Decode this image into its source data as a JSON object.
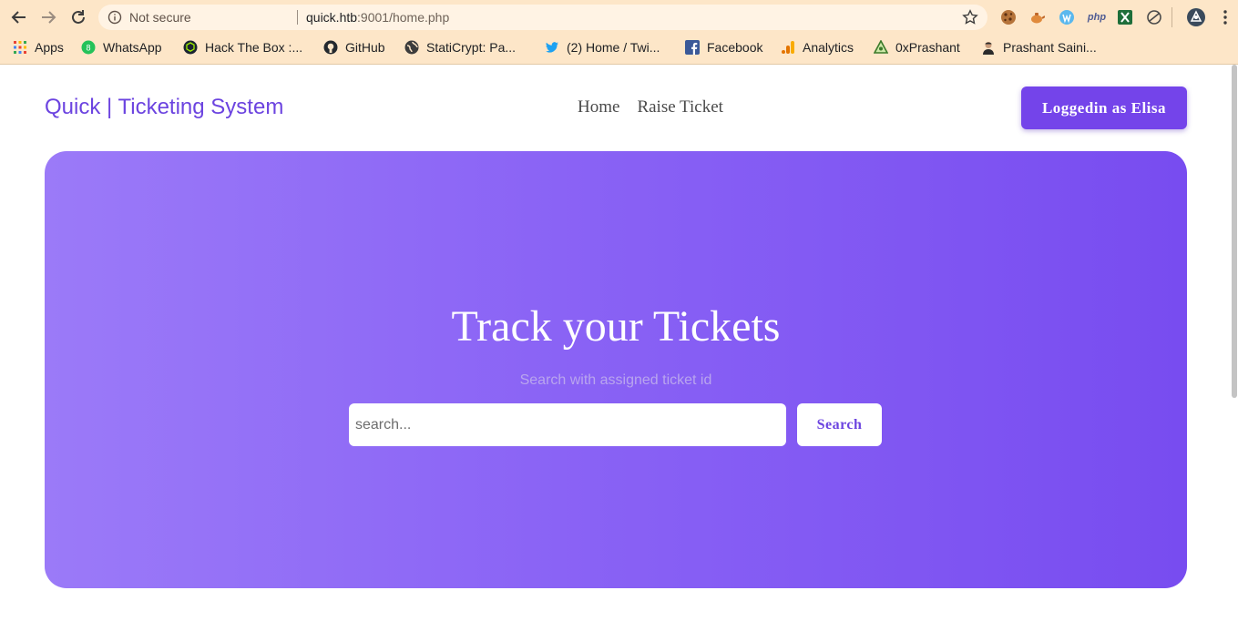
{
  "browser": {
    "security_label": "Not secure",
    "url_host": "quick.htb",
    "url_rest": ":9001/home.php",
    "bookmarks": [
      {
        "label": "Apps",
        "icon": "apps-grid-icon"
      },
      {
        "label": "WhatsApp",
        "icon": "whatsapp-icon"
      },
      {
        "label": "Hack The Box :...",
        "icon": "hackthebox-icon"
      },
      {
        "label": "GitHub",
        "icon": "github-icon"
      },
      {
        "label": "StatiCrypt: Pa...",
        "icon": "globe-icon"
      },
      {
        "label": "(2) Home / Twi...",
        "icon": "twitter-icon"
      },
      {
        "label": "Facebook",
        "icon": "facebook-icon"
      },
      {
        "label": "Analytics",
        "icon": "analytics-icon"
      },
      {
        "label": "0xPrashant",
        "icon": "triangle-logo-icon"
      },
      {
        "label": "Prashant Saini...",
        "icon": "avatar-icon"
      }
    ],
    "extension_php_label": "php"
  },
  "header": {
    "brand": "Quick | Ticketing System",
    "nav": [
      "Home",
      "Raise Ticket"
    ],
    "login_label": "Loggedin as Elisa"
  },
  "hero": {
    "title": "Track your Tickets",
    "subtitle": "Search with assigned ticket id",
    "search_placeholder": "search...",
    "search_button": "Search"
  },
  "colors": {
    "accent": "#7444ea",
    "hero_gradient_start": "#9b7af8",
    "hero_gradient_end": "#784cf0",
    "chrome_bg": "#fde6c8"
  }
}
